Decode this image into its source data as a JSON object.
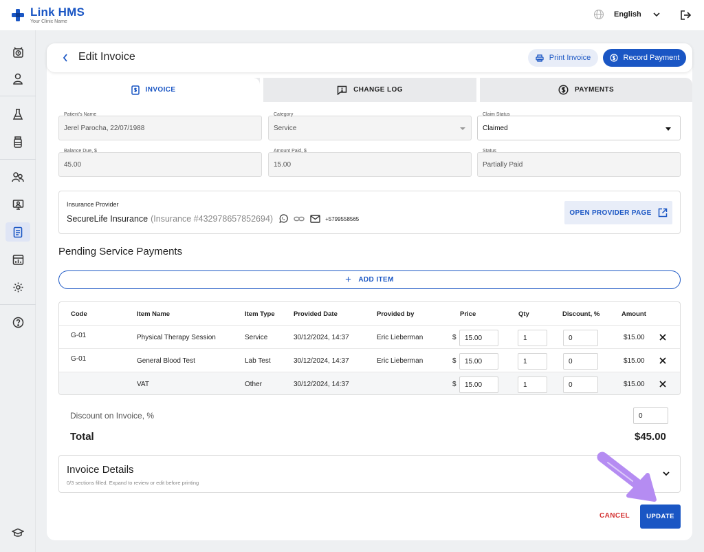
{
  "app": {
    "name": "Link HMS",
    "subtitle": "Your Clinic Name",
    "language": "English"
  },
  "page": {
    "title": "Edit Invoice",
    "print_label": "Print Invoice",
    "record_label": "Record Payment"
  },
  "tabs": [
    {
      "label": "INVOICE",
      "icon": "invoice-icon",
      "active": true
    },
    {
      "label": "CHANGE LOG",
      "icon": "comment-alert-icon",
      "active": false
    },
    {
      "label": "PAYMENTS",
      "icon": "dollar-circle-icon",
      "active": false
    }
  ],
  "fields": {
    "patient": {
      "label": "Patient's Name",
      "value": "Jerel Parocha, 22/07/1988"
    },
    "category": {
      "label": "Category",
      "value": "Service"
    },
    "claim_status": {
      "label": "Claim Status",
      "value": "Claimed"
    },
    "balance_due": {
      "label": "Balance Due, $",
      "value": "45.00"
    },
    "amount_paid": {
      "label": "Amount Paid, $",
      "value": "15.00"
    },
    "status": {
      "label": "Status",
      "value": "Partially Paid"
    }
  },
  "insurance": {
    "label": "Insurance Provider",
    "name": "SecureLife Insurance",
    "number": "(Insurance #432978657852694)",
    "phone": "+5799558565",
    "open_label": "OPEN PROVIDER PAGE"
  },
  "pending": {
    "title": "Pending Service Payments",
    "add_label": "ADD ITEM"
  },
  "table": {
    "headers": [
      "Code",
      "Item Name",
      "Item Type",
      "Provided Date",
      "Provided by",
      "Price",
      "Qty",
      "Discount, %",
      "Amount"
    ],
    "currency": "$",
    "rows": [
      {
        "code": "G-01",
        "name": "Physical Therapy Session",
        "type": "Service",
        "date": "30/12/2024, 14:37",
        "by": "Eric Lieberman",
        "price": "15.00",
        "qty": "1",
        "discount": "0",
        "amount": "$15.00"
      },
      {
        "code": "G-01",
        "name": "General Blood Test",
        "type": "Lab Test",
        "date": "30/12/2024, 14:37",
        "by": "Eric Lieberman",
        "price": "15.00",
        "qty": "1",
        "discount": "0",
        "amount": "$15.00"
      },
      {
        "code": "",
        "name": "VAT",
        "type": "Other",
        "date": "30/12/2024, 14:37",
        "by": "",
        "price": "15.00",
        "qty": "1",
        "discount": "0",
        "amount": "$15.00"
      }
    ]
  },
  "summary": {
    "discount_label": "Discount on Invoice, %",
    "discount_value": "0",
    "total_label": "Total",
    "total_value": "$45.00"
  },
  "details": {
    "title": "Invoice Details",
    "subtitle": "0/3 sections filled. Expand to review or edit before printing"
  },
  "actions": {
    "cancel": "CANCEL",
    "update": "UPDATE"
  },
  "colors": {
    "accent": "#1a56c4",
    "danger": "#d32f2f",
    "highlight": "#b58cf2"
  }
}
